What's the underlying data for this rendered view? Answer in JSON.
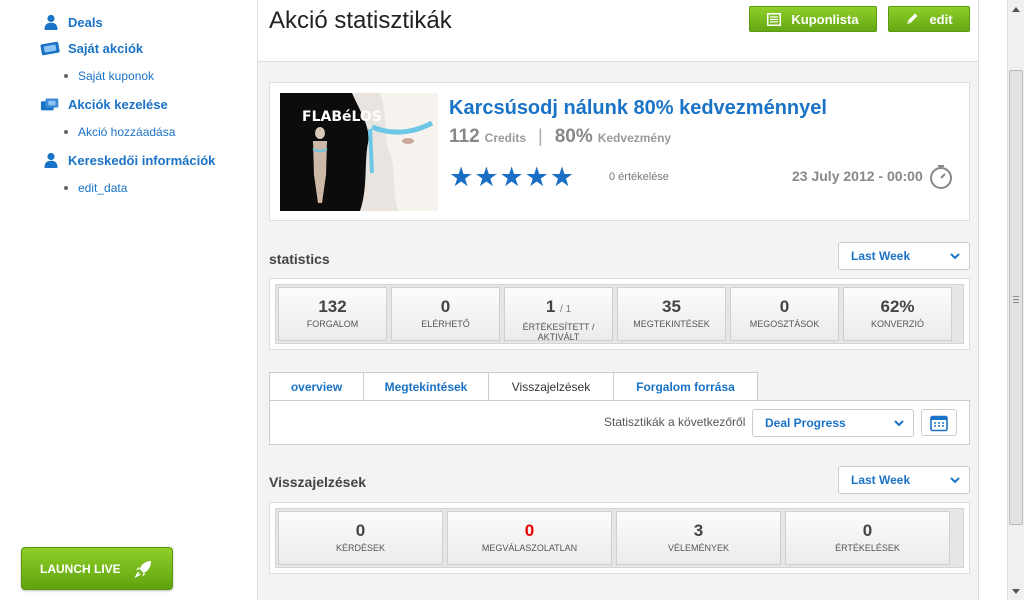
{
  "sidebar": {
    "items": [
      {
        "label": "Deals",
        "icon": "user-icon"
      },
      {
        "label": "Saját akciók",
        "icon": "tickets-icon"
      },
      {
        "label": "Akciók kezelése",
        "icon": "tickets-stack-icon"
      },
      {
        "label": "Kereskedői információk",
        "icon": "user-icon"
      }
    ],
    "subitems": [
      {
        "label": "Saját kuponok"
      },
      {
        "label": "Akció hozzáadása"
      },
      {
        "label": "edit_data"
      }
    ],
    "launch_label": "LAUNCH LIVE"
  },
  "header": {
    "title": "Akció statisztikák",
    "kuponlista_label": "Kuponlista",
    "edit_label": "edit"
  },
  "deal": {
    "title": "Karcsúsodj nálunk 80% kedvezménnyel",
    "credits_value": "112",
    "credits_unit": "Credits",
    "separator": "|",
    "discount_value": "80%",
    "discount_unit": "Kedvezmény",
    "rating": 5,
    "rating_count": "0 értékelése",
    "date": "23 July 2012 - 00:00",
    "image_brand": "FLABéLOS"
  },
  "statistics": {
    "title": "statistics",
    "period": "Last Week",
    "items": [
      {
        "value": "132",
        "label": "FORGALOM"
      },
      {
        "value": "0",
        "label": "ELÉRHETŐ"
      },
      {
        "value": "1",
        "sub": "/ 1",
        "label": "ÉRTÉKESÍTETT / AKTIVÁLT"
      },
      {
        "value": "35",
        "label": "MEGTEKINTÉSEK"
      },
      {
        "value": "0",
        "label": "MEGOSZTÁSOK"
      },
      {
        "value": "62%",
        "label": "KONVERZIÓ"
      }
    ]
  },
  "tabs": [
    {
      "label": "overview"
    },
    {
      "label": "Megtekintések"
    },
    {
      "label": "Visszajelzések"
    },
    {
      "label": "Forgalom forrása"
    }
  ],
  "filter": {
    "label": "Statisztikák a következőről",
    "selected": "Deal Progress"
  },
  "feedback": {
    "title": "Visszajelzések",
    "period": "Last Week",
    "items": [
      {
        "value": "0",
        "label": "KÉRDÉSEK"
      },
      {
        "value": "0",
        "label": "MEGVÁLASZOLATLAN"
      },
      {
        "value": "3",
        "label": "VÉLEMÉNYEK"
      },
      {
        "value": "0",
        "label": "ÉRTÉKELÉSEK"
      }
    ]
  },
  "colors": {
    "accent_blue": "#1a73c6",
    "button_green": "#6fb71a",
    "alert_red": "#ee0000"
  }
}
